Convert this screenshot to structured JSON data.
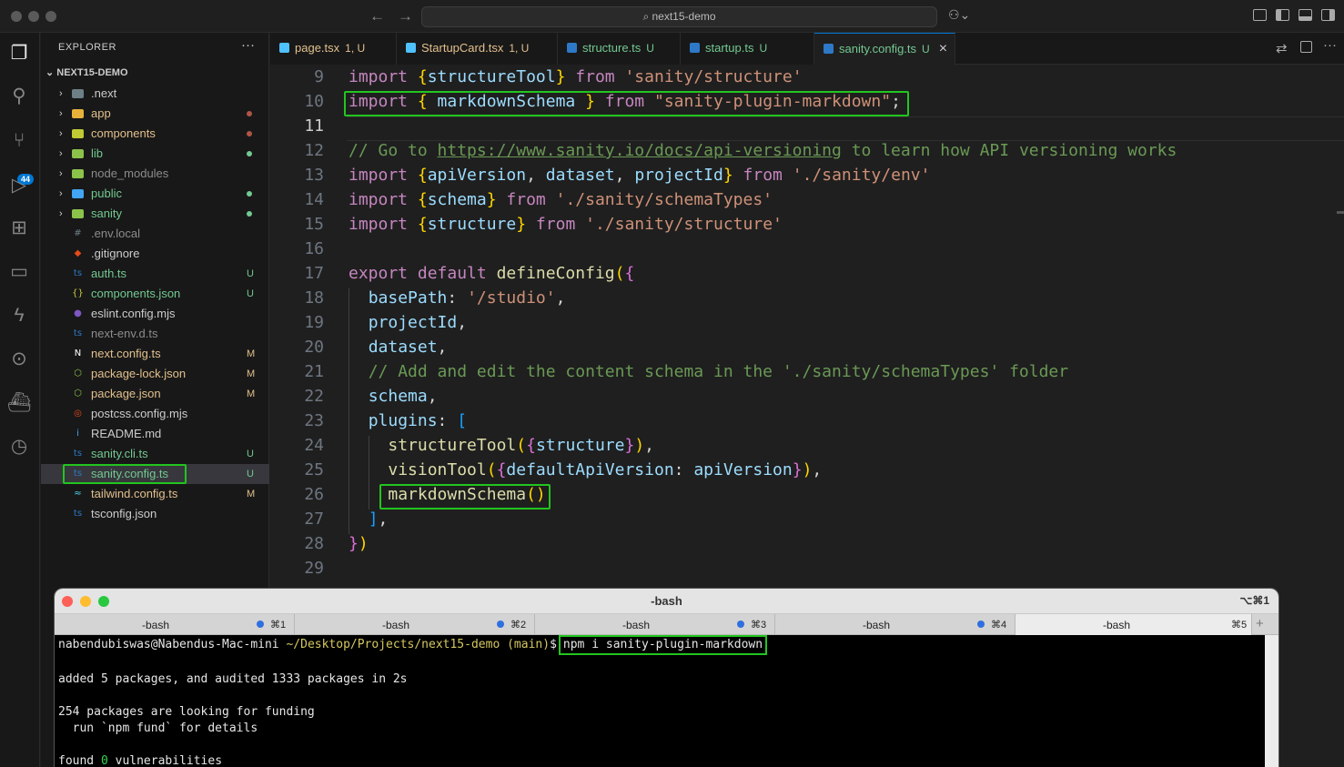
{
  "window": {
    "search": "next15-demo"
  },
  "activity": {
    "badge": "44"
  },
  "explorer": {
    "title": "EXPLORER",
    "more": "···",
    "root": "NEXT15-DEMO",
    "items": [
      {
        "name": ".next",
        "folder": true,
        "icon_color": "#6d8086",
        "status": "",
        "dot": ""
      },
      {
        "name": "app",
        "folder": true,
        "icon_color": "#e8b23a",
        "status": "",
        "dot": "#b05545",
        "name_color": "#e2c08d"
      },
      {
        "name": "components",
        "folder": true,
        "icon_color": "#c0ca33",
        "status": "",
        "dot": "#b05545",
        "name_color": "#e2c08d"
      },
      {
        "name": "lib",
        "folder": true,
        "icon_color": "#8bc34a",
        "status": "",
        "dot": "#73c991",
        "name_color": "#73c991"
      },
      {
        "name": "node_modules",
        "folder": true,
        "icon_color": "#8bc34a",
        "status": "",
        "dot": "",
        "name_color": "#8c8c8c"
      },
      {
        "name": "public",
        "folder": true,
        "icon_color": "#42a5f5",
        "status": "",
        "dot": "#73c991",
        "name_color": "#73c991"
      },
      {
        "name": "sanity",
        "folder": true,
        "icon_color": "#8bc34a",
        "status": "",
        "dot": "#73c991",
        "name_color": "#73c991"
      },
      {
        "name": ".env.local",
        "folder": false,
        "icon_color": "#6d8086",
        "icon": "#",
        "status": "",
        "name_color": "#8c8c8c"
      },
      {
        "name": ".gitignore",
        "folder": false,
        "icon_color": "#e64a19",
        "icon": "◆",
        "status": "",
        "name_color": "#cccccc"
      },
      {
        "name": "auth.ts",
        "folder": false,
        "icon_color": "#2d79c7",
        "icon": "ts",
        "status": "U",
        "name_color": "#73c991"
      },
      {
        "name": "components.json",
        "folder": false,
        "icon_color": "#cbcb41",
        "icon": "{}",
        "status": "U",
        "name_color": "#73c991"
      },
      {
        "name": "eslint.config.mjs",
        "folder": false,
        "icon_color": "#7e57c2",
        "icon": "●",
        "status": "",
        "name_color": "#cccccc"
      },
      {
        "name": "next-env.d.ts",
        "folder": false,
        "icon_color": "#2d79c7",
        "icon": "ts",
        "status": "",
        "name_color": "#8c8c8c"
      },
      {
        "name": "next.config.ts",
        "folder": false,
        "icon_color": "#ffffff",
        "icon": "N",
        "status": "M",
        "name_color": "#e2c08d"
      },
      {
        "name": "package-lock.json",
        "folder": false,
        "icon_color": "#8bc34a",
        "icon": "⬡",
        "status": "M",
        "name_color": "#e2c08d"
      },
      {
        "name": "package.json",
        "folder": false,
        "icon_color": "#8bc34a",
        "icon": "⬡",
        "status": "M",
        "name_color": "#e2c08d"
      },
      {
        "name": "postcss.config.mjs",
        "folder": false,
        "icon_color": "#e64a19",
        "icon": "◎",
        "status": "",
        "name_color": "#cccccc"
      },
      {
        "name": "README.md",
        "folder": false,
        "icon_color": "#42a5f5",
        "icon": "i",
        "status": "",
        "name_color": "#cccccc"
      },
      {
        "name": "sanity.cli.ts",
        "folder": false,
        "icon_color": "#2d79c7",
        "icon": "ts",
        "status": "U",
        "name_color": "#73c991"
      },
      {
        "name": "sanity.config.ts",
        "folder": false,
        "icon_color": "#2d79c7",
        "icon": "ts",
        "status": "U",
        "name_color": "#73c991",
        "selected": true
      },
      {
        "name": "tailwind.config.ts",
        "folder": false,
        "icon_color": "#4dd0e1",
        "icon": "≈",
        "status": "M",
        "name_color": "#e2c08d"
      },
      {
        "name": "tsconfig.json",
        "folder": false,
        "icon_color": "#2d79c7",
        "icon": "ts",
        "status": "",
        "name_color": "#cccccc"
      }
    ]
  },
  "tabs": [
    {
      "label": "page.tsx",
      "status": "1, U",
      "color": "#e2c08d",
      "status_color": "#e2c08d",
      "icon_color": "#4fc1ff"
    },
    {
      "label": "StartupCard.tsx",
      "status": "1, U",
      "color": "#e2c08d",
      "status_color": "#e2c08d",
      "icon_color": "#4fc1ff"
    },
    {
      "label": "structure.ts",
      "status": "U",
      "color": "#73c991",
      "status_color": "#73c991",
      "icon_color": "#2d79c7"
    },
    {
      "label": "startup.ts",
      "status": "U",
      "color": "#73c991",
      "status_color": "#73c991",
      "icon_color": "#2d79c7"
    },
    {
      "label": "sanity.config.ts",
      "status": "U",
      "color": "#73c991",
      "status_color": "#73c991",
      "icon_color": "#2d79c7",
      "active": true,
      "close": "×"
    }
  ],
  "editor": {
    "current_line": 11,
    "lines": [
      {
        "n": 9,
        "t": [
          [
            "kw",
            "import "
          ],
          [
            "b1",
            "{"
          ],
          [
            "vr",
            "structureTool"
          ],
          [
            "b1",
            "}"
          ],
          [
            "kw",
            " from "
          ],
          [
            "str",
            "'sanity/structure'"
          ]
        ]
      },
      {
        "n": 10,
        "t": [
          [
            "kw",
            "import "
          ],
          [
            "b1",
            "{ "
          ],
          [
            "vr",
            "markdownSchema"
          ],
          [
            "b1",
            " }"
          ],
          [
            "kw",
            " from "
          ],
          [
            "str",
            "\"sanity-plugin-markdown\""
          ],
          [
            "",
            "; "
          ]
        ]
      },
      {
        "n": 11,
        "t": []
      },
      {
        "n": 12,
        "t": [
          [
            "cm",
            "// Go to "
          ],
          [
            "cm lnk",
            "https://www.sanity.io/docs/api-versioning"
          ],
          [
            "cm",
            " to learn how API versioning works"
          ]
        ]
      },
      {
        "n": 13,
        "t": [
          [
            "kw",
            "import "
          ],
          [
            "b1",
            "{"
          ],
          [
            "vr",
            "apiVersion"
          ],
          [
            "",
            ", "
          ],
          [
            "vr",
            "dataset"
          ],
          [
            "",
            ", "
          ],
          [
            "vr",
            "projectId"
          ],
          [
            "b1",
            "}"
          ],
          [
            "kw",
            " from "
          ],
          [
            "str",
            "'./sanity/env'"
          ]
        ]
      },
      {
        "n": 14,
        "t": [
          [
            "kw",
            "import "
          ],
          [
            "b1",
            "{"
          ],
          [
            "vr",
            "schema"
          ],
          [
            "b1",
            "}"
          ],
          [
            "kw",
            " from "
          ],
          [
            "str",
            "'./sanity/schemaTypes'"
          ]
        ]
      },
      {
        "n": 15,
        "t": [
          [
            "kw",
            "import "
          ],
          [
            "b1",
            "{"
          ],
          [
            "vr",
            "structure"
          ],
          [
            "b1",
            "}"
          ],
          [
            "kw",
            " from "
          ],
          [
            "str",
            "'./sanity/structure'"
          ]
        ]
      },
      {
        "n": 16,
        "t": []
      },
      {
        "n": 17,
        "t": [
          [
            "kw",
            "export default "
          ],
          [
            "fn",
            "defineConfig"
          ],
          [
            "b1",
            "("
          ],
          [
            "b2",
            "{"
          ]
        ]
      },
      {
        "n": 18,
        "t": [
          [
            "",
            "  "
          ],
          [
            "vr",
            "basePath"
          ],
          [
            "",
            ": "
          ],
          [
            "str",
            "'/studio'"
          ],
          [
            "",
            ","
          ]
        ]
      },
      {
        "n": 19,
        "t": [
          [
            "",
            "  "
          ],
          [
            "vr",
            "projectId"
          ],
          [
            "",
            ","
          ]
        ]
      },
      {
        "n": 20,
        "t": [
          [
            "",
            "  "
          ],
          [
            "vr",
            "dataset"
          ],
          [
            "",
            ","
          ]
        ]
      },
      {
        "n": 21,
        "t": [
          [
            "",
            "  "
          ],
          [
            "cm",
            "// Add and edit the content schema in the './sanity/schemaTypes' folder"
          ]
        ]
      },
      {
        "n": 22,
        "t": [
          [
            "",
            "  "
          ],
          [
            "vr",
            "schema"
          ],
          [
            "",
            ","
          ]
        ]
      },
      {
        "n": 23,
        "t": [
          [
            "",
            "  "
          ],
          [
            "vr",
            "plugins"
          ],
          [
            "",
            ": "
          ],
          [
            "b3",
            "["
          ]
        ]
      },
      {
        "n": 24,
        "t": [
          [
            "",
            "    "
          ],
          [
            "fn",
            "structureTool"
          ],
          [
            "b1",
            "("
          ],
          [
            "b2",
            "{"
          ],
          [
            "vr",
            "structure"
          ],
          [
            "b2",
            "}"
          ],
          [
            "b1",
            ")"
          ],
          [
            "",
            ","
          ]
        ]
      },
      {
        "n": 25,
        "t": [
          [
            "",
            "    "
          ],
          [
            "fn",
            "visionTool"
          ],
          [
            "b1",
            "("
          ],
          [
            "b2",
            "{"
          ],
          [
            "vr",
            "defaultApiVersion"
          ],
          [
            "",
            ": "
          ],
          [
            "vr",
            "apiVersion"
          ],
          [
            "b2",
            "}"
          ],
          [
            "b1",
            ")"
          ],
          [
            "",
            ","
          ]
        ]
      },
      {
        "n": 26,
        "t": [
          [
            "",
            "    "
          ],
          [
            "fn",
            "markdownSchema"
          ],
          [
            "b1",
            "()"
          ]
        ]
      },
      {
        "n": 27,
        "t": [
          [
            "",
            "  "
          ],
          [
            "b3",
            "]"
          ],
          [
            "",
            ","
          ]
        ]
      },
      {
        "n": 28,
        "t": [
          [
            "b2",
            "}"
          ],
          [
            "b1",
            ")"
          ]
        ]
      },
      {
        "n": 29,
        "t": []
      }
    ]
  },
  "terminal": {
    "title": "-bash",
    "shortcut": "⌥⌘1",
    "plus": "+",
    "tabs": [
      {
        "name": "-bash",
        "shortcut": "⌘1",
        "dot": true
      },
      {
        "name": "-bash",
        "shortcut": "⌘2",
        "dot": true
      },
      {
        "name": "-bash",
        "shortcut": "⌘3",
        "dot": true
      },
      {
        "name": "-bash",
        "shortcut": "⌘4",
        "dot": true
      },
      {
        "name": "-bash",
        "shortcut": "⌘5",
        "dot": false,
        "active": true
      }
    ],
    "prompt_user": "nabendubiswas@Nabendus-Mac-mini",
    "prompt_path": "~/Desktop/Projects/next15-demo",
    "prompt_branch": "(main)",
    "prompt_sign": "$",
    "command": "npm i sanity-plugin-markdown",
    "output": [
      "",
      "added 5 packages, and audited 1333 packages in 2s",
      "",
      "254 packages are looking for funding",
      "  run `npm fund` for details",
      ""
    ],
    "found_prefix": "found ",
    "found_count": "0",
    "found_suffix": " vulnerabilities"
  }
}
